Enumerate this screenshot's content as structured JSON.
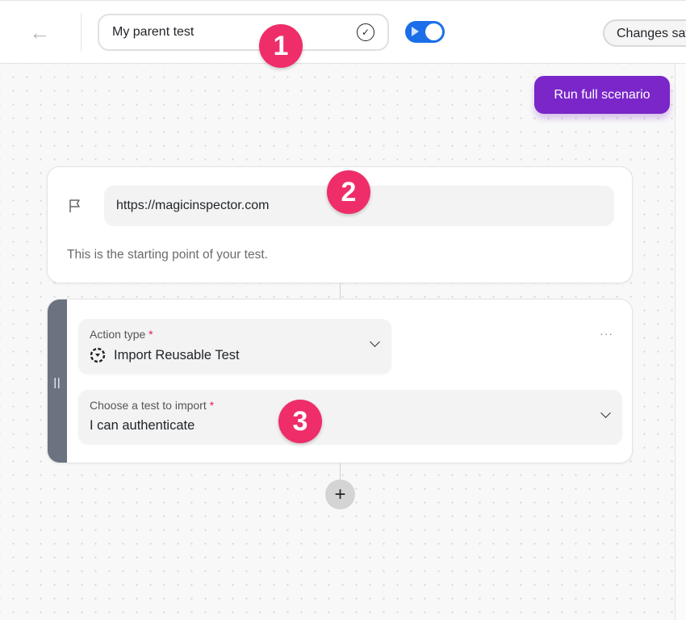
{
  "header": {
    "back_icon": "arrow-left-icon",
    "title_value": "My parent test",
    "check_icon": "check-circle-icon",
    "toggle_on": true,
    "changes_label": "Changes saved"
  },
  "toolbar": {
    "run_label": "Run full scenario"
  },
  "start_card": {
    "flag_icon": "flag-icon",
    "url": "https://magicinspector.com",
    "hint": "This is the starting point of your test."
  },
  "step_card": {
    "drag_handle": "||",
    "menu": "···",
    "action_type": {
      "label": "Action type",
      "required": "*",
      "value": "Import Reusable Test",
      "icon": "import-reusable-icon"
    },
    "choose_test": {
      "label": "Choose a test to import",
      "required": "*",
      "value": "I can authenticate"
    }
  },
  "add_step": {
    "label": "+"
  },
  "annotations": [
    "1",
    "2",
    "3"
  ],
  "colors": {
    "accent": "#7a26c9",
    "toggle": "#1a6fe8",
    "badge": "#ee2d69",
    "required": "#e8185b"
  }
}
